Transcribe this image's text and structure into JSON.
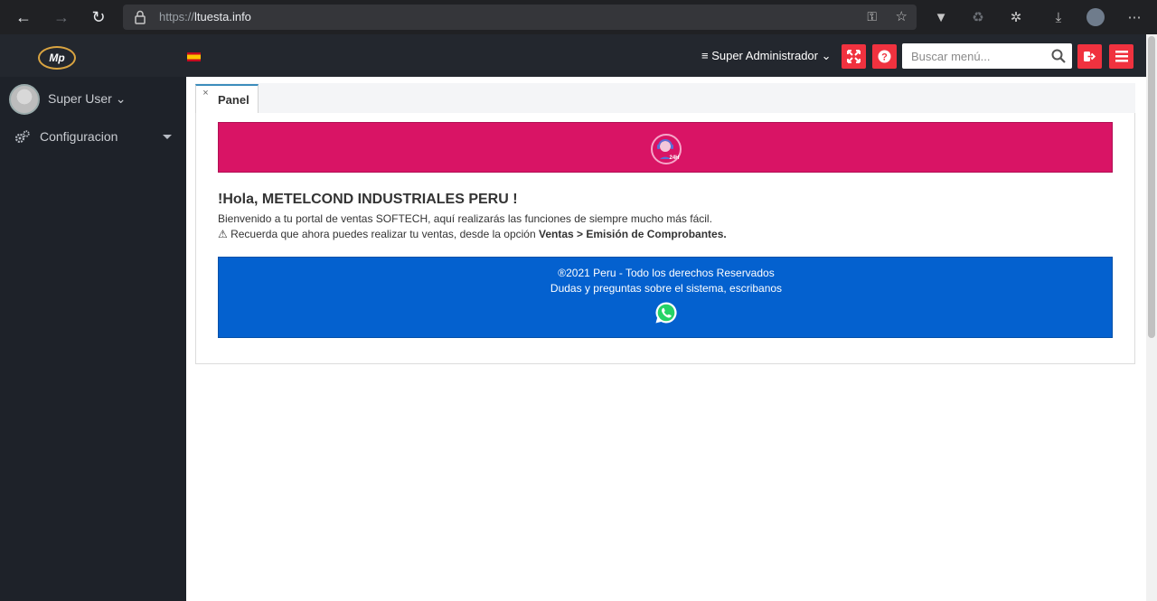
{
  "browser": {
    "url_scheme": "https://",
    "url_host": "ltuesta.info"
  },
  "header": {
    "logo_text": "Mp",
    "admin_label": "≡ Super Administrador ⌄",
    "search_placeholder": "Buscar menú..."
  },
  "sidebar": {
    "user_name": "Super User ⌄",
    "items": [
      {
        "label": "Configuracion"
      }
    ]
  },
  "tabs": [
    {
      "label": "Panel",
      "close": "×"
    }
  ],
  "content": {
    "greeting": "!Hola, METELCOND INDUSTRIALES PERU !",
    "welcome": "Bienvenido a tu portal de ventas SOFTECH, aquí realizarás las funciones de siempre mucho más fácil.",
    "notice_prefix": "⚠ Recuerda que ahora puedes realizar tu ventas, desde la opción ",
    "notice_bold": "Ventas > Emisión de Comprobantes.",
    "footer_copy": "®2021 Peru - Todo los derechos Reservados",
    "footer_doubts": "Dudas y preguntas sobre el sistema, escribanos",
    "support_badge": "24H"
  },
  "colors": {
    "header_bg": "#23272e",
    "sidebar_bg": "#1e2229",
    "action_red": "#f0323f",
    "banner_pink": "#d91465",
    "banner_blue": "#0461cf",
    "whatsapp_green": "#25d366"
  }
}
